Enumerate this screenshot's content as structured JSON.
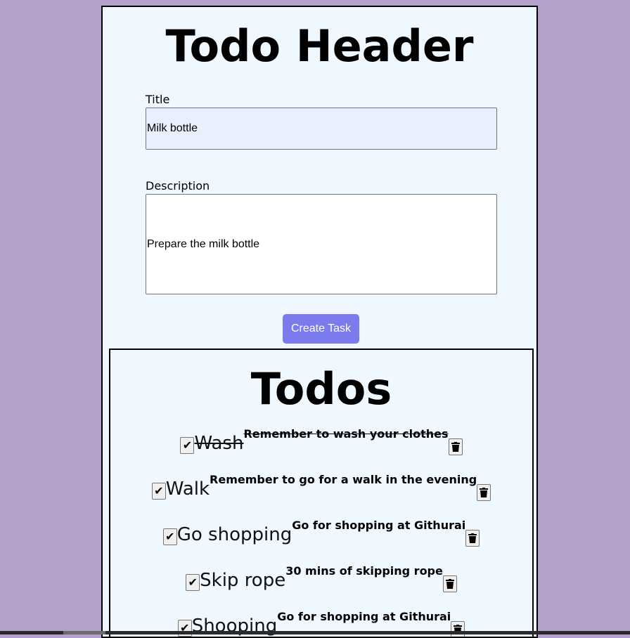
{
  "header": {
    "title": "Todo Header"
  },
  "form": {
    "title_label": "Title",
    "title_value": "Milk bottle",
    "description_label": "Description",
    "description_value": "Prepare the milk bottle",
    "create_label": "Create Task"
  },
  "todos": {
    "heading": "Todos",
    "items": [
      {
        "title": "Wash",
        "description": "Remember to wash your clothes",
        "completed": true,
        "struck": true
      },
      {
        "title": "Walk",
        "description": "Remember to go for a walk in the evening",
        "completed": true,
        "struck": false
      },
      {
        "title": "Go shopping",
        "description": "Go for shopping at Githurai",
        "completed": true,
        "struck": false
      },
      {
        "title": "Skip rope",
        "description": "30 mins of skipping rope",
        "completed": true,
        "struck": false
      },
      {
        "title": "Shooping",
        "description": "Go for shopping at Githurai",
        "completed": true,
        "struck": false
      }
    ]
  },
  "icons": {
    "check": "check-icon",
    "delete": "trash-icon"
  },
  "colors": {
    "page_background": "#b3a1cb",
    "panel_background": "#eff7ff",
    "button_background": "#7b7bee",
    "title_input_background": "#e8f0fe"
  }
}
